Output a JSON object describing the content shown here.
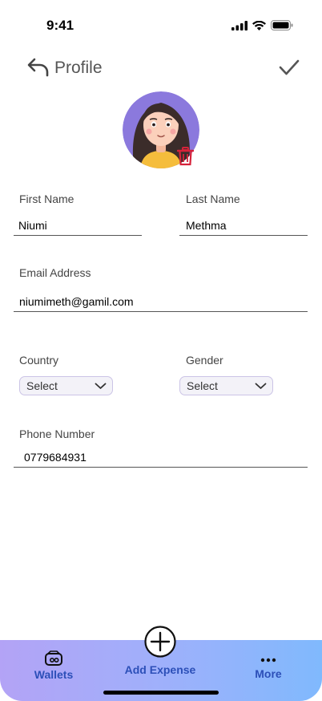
{
  "status_bar": {
    "time": "9:41"
  },
  "header": {
    "title": "Profile"
  },
  "form": {
    "first_name": {
      "label": "First Name",
      "value": "Niumi"
    },
    "last_name": {
      "label": "Last Name",
      "value": "Methma"
    },
    "email": {
      "label": "Email Address",
      "value": "niumimeth@gamil.com"
    },
    "country": {
      "label": "Country",
      "selected": "Select"
    },
    "gender": {
      "label": "Gender",
      "selected": "Select"
    },
    "phone": {
      "label": "Phone Number",
      "value": "0779684931"
    }
  },
  "bottom_nav": {
    "wallets_label": "Wallets",
    "add_expense_label": "Add Expense",
    "more_label": "More"
  },
  "colors": {
    "accent_purple": "#8f7be0",
    "delete_red": "#d6223a",
    "nav_text": "#2c4fb8"
  },
  "icons": [
    "back-arrow-icon",
    "checkmark-icon",
    "trash-icon",
    "wallet-icon",
    "plus-circle-icon",
    "more-dots-icon",
    "chevron-down-icon"
  ]
}
